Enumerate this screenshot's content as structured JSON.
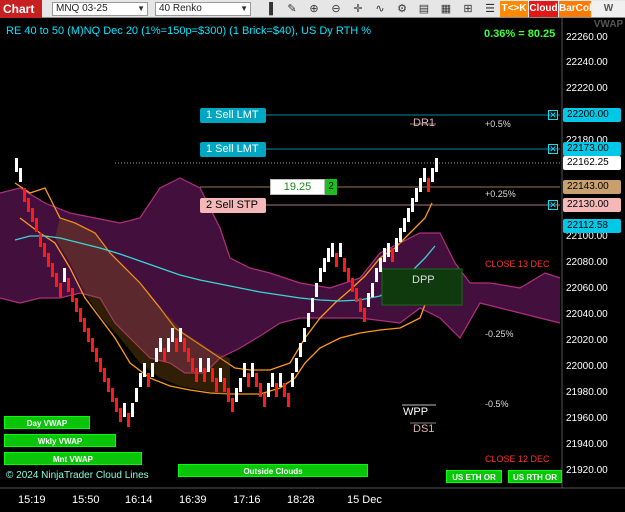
{
  "toolbar": {
    "tab": "Chart",
    "instrument": "MNQ 03-25",
    "bar_type": "40 Renko",
    "icons": [
      "bar-style-icon",
      "draw-line-icon",
      "zoom-in-icon",
      "zoom-out-icon",
      "crosshair-icon",
      "indicators-icon",
      "strategies-icon",
      "templates-icon",
      "chart-trader-icon",
      "data-box-icon"
    ],
    "buttons": {
      "tk": "T<>K",
      "cloud": "Cloud",
      "barcol": "BarCol",
      "vwap": "W VWAP"
    }
  },
  "chart": {
    "title": "RE 40 to 50 (M)NQ Dec 20 (1%=150p=$300) (1 Brick=$40), US Dy RTH %",
    "pl": "0.36% = 80.25",
    "price_axis": [
      "22260.00",
      "22240.00",
      "22220.00",
      "22200.00",
      "22180.00",
      "22160.00",
      "22140.00",
      "22120.00",
      "22100.00",
      "22080.00",
      "22060.00",
      "22040.00",
      "22020.00",
      "22000.00",
      "21980.00",
      "21960.00",
      "21940.00",
      "21920.00"
    ],
    "time_axis": [
      "15:19",
      "15:50",
      "16:14",
      "16:39",
      "17:16",
      "18:28",
      "15 Dec"
    ],
    "orders": [
      {
        "label": "1 Sell LMT",
        "price": "22200.00"
      },
      {
        "label": "1 Sell LMT",
        "price": "22173.00"
      },
      {
        "label": "2 Sell STP",
        "price": "22130.00"
      }
    ],
    "last_price": "22162.25",
    "position_price": "22143.00",
    "other_price": "22112.58",
    "qty_value": "19.25",
    "qty_count": "2",
    "levels": {
      "dr1": "DR1",
      "plus05": "+0.5%",
      "plus025": "+0.25%",
      "dpp": "DPP",
      "close13": "CLOSE 13 DEC",
      "minus025": "-0.25%",
      "minus05": "-0.5%",
      "wpp": "WPP",
      "ds1": "DS1",
      "close12": "CLOSE 12 DEC"
    },
    "indicator_buttons": {
      "day_vwap": "Day VWAP",
      "wkly_vwap": "Wkly VWAP",
      "mnt_vwap": "Mnt VWAP",
      "outside_clouds": "Outside Clouds",
      "us_eth": "US ETH OR",
      "us_rth": "US RTH OR"
    },
    "footer_text": "© 2024 NinjaTrader Cloud Lines",
    "colors": {
      "up": "#ffffff",
      "down": "#ff1a1a",
      "cloud": "#5a1450",
      "accent": "#00e5ff",
      "orange": "#ff9a1a"
    }
  }
}
